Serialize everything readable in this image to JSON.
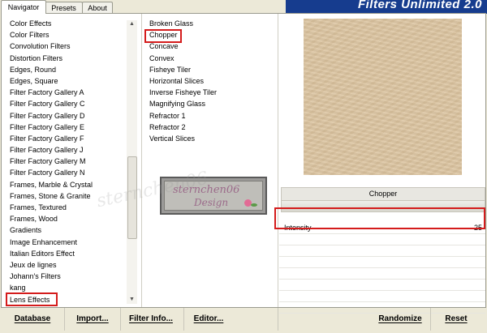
{
  "app": {
    "title": "Filters Unlimited 2.0"
  },
  "tabs": [
    "Navigator",
    "Presets",
    "About"
  ],
  "categories": [
    "Color Effects",
    "Color Filters",
    "Convolution Filters",
    "Distortion Filters",
    "Edges, Round",
    "Edges, Square",
    "Filter Factory Gallery A",
    "Filter Factory Gallery C",
    "Filter Factory Gallery D",
    "Filter Factory Gallery E",
    "Filter Factory Gallery F",
    "Filter Factory Gallery J",
    "Filter Factory Gallery M",
    "Filter Factory Gallery N",
    "Frames, Marble & Crystal",
    "Frames, Stone & Granite",
    "Frames, Textured",
    "Frames, Wood",
    "Gradients",
    "Image Enhancement",
    "Italian Editors Effect",
    "Jeux de lignes",
    "Johann's Filters",
    "kang",
    "Lens Effects"
  ],
  "selected_category": "Lens Effects",
  "filters": [
    "Broken Glass",
    "Chopper",
    "Concave",
    "Convex",
    "Fisheye Tiler",
    "Horizontal Slices",
    "Inverse Fisheye Tiler",
    "Magnifying Glass",
    "Refractor 1",
    "Refractor 2",
    "Vertical Slices"
  ],
  "selected_filter": "Chopper",
  "preview": {
    "filter_name": "Chopper"
  },
  "parameters": [
    {
      "label": "Intensity",
      "value": "25"
    }
  ],
  "watermark": {
    "line1": "sternchen06",
    "line2": "Design",
    "overlay": "sternchen06"
  },
  "buttons": {
    "database": "Database",
    "import": "Import...",
    "filter_info": "Filter Info...",
    "editor": "Editor...",
    "randomize": "Randomize",
    "reset": "Reset"
  },
  "colors": {
    "highlight": "#d41c1c",
    "banner": "#163c8e",
    "preview": "#dcc5a1"
  }
}
